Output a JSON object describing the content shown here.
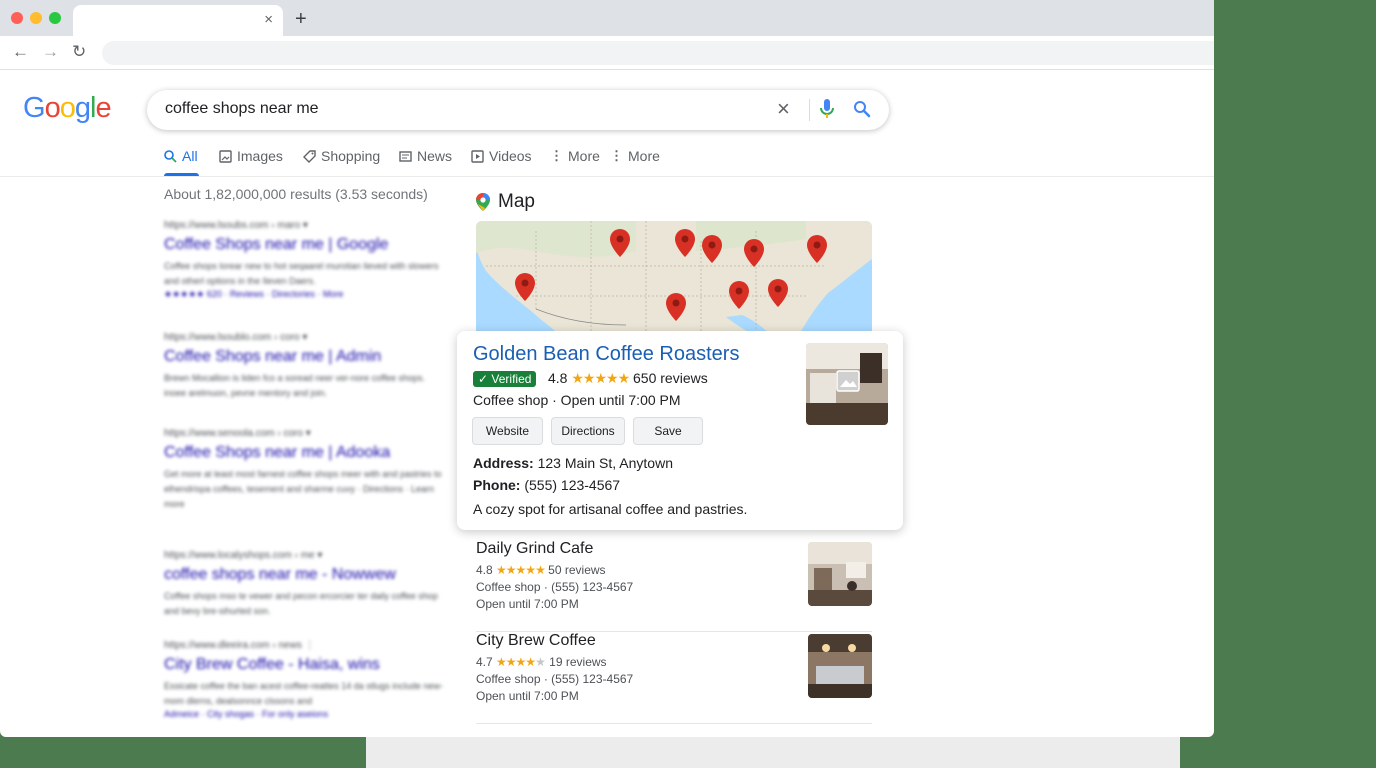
{
  "browser": {
    "tab_close": "×",
    "new_tab": "+",
    "back": "←",
    "forward": "→",
    "reload": "↻",
    "menu": "⋮"
  },
  "google": {
    "logo_letters": [
      "G",
      "o",
      "o",
      "g",
      "l",
      "e"
    ],
    "logo_colors": [
      "#4285f4",
      "#ea4335",
      "#fbbc05",
      "#4285f4",
      "#34a853",
      "#ea4335"
    ],
    "query": "coffee shops near me",
    "clear": "×"
  },
  "tabs": [
    {
      "label": "All",
      "icon": "search-icon",
      "active": true
    },
    {
      "label": "Images",
      "icon": "image-icon"
    },
    {
      "label": "Shopping",
      "icon": "tag-icon"
    },
    {
      "label": "News",
      "icon": "news-icon"
    },
    {
      "label": "Videos",
      "icon": "video-icon"
    },
    {
      "label": "More",
      "icon": "dots-vertical-icon"
    },
    {
      "label": "More",
      "icon": "dots-vertical-icon"
    }
  ],
  "result_stats": "About 1,82,000,000 results (3.53 seconds)",
  "results": [
    {
      "url": "https://www.lsoubs.com › maro ▾",
      "title": "Coffee Shops near me | Google",
      "snippet": "Coffee shops lorear new to hot seqaarel murotian lieved with slowers and otherl options in the Ileven Daers.",
      "links": "★★★★★ 620 · Reviews · Directories · More"
    },
    {
      "url": "https://www.lsoublo.com › coro ▾",
      "title": "Coffee Shops near me | Admin",
      "snippet": "Brewn Mocallion is liden fco a soread neer ver-nore coffee shops. inoee arelmuon, pevne mentory and join."
    },
    {
      "url": "https://www.senoola.com › coro ▾",
      "title": "Coffee Shops near me | Adooka",
      "snippet": "Get more at least most farnest coffee shops meer with and pastries to elhendrispa coffees, tesement and sharme cuvy · Directions · Learn more"
    },
    {
      "url": "https://www.localyshops.com › me ▾",
      "title": "coffee shops near me - Nowwew",
      "snippet": "Coffee shops mso te vewer and pecon ercorcier ter daily coffee shop and bevy bre-sihurted son."
    },
    {
      "url": "https://www.dleeira.com › news ⋮",
      "title": "City Brew Coffee - Haisa, wins",
      "snippet": "Essicate coffee the ban acest coffee-reattes 14 da stlugs include new-mom dlerns, dealsonnce clssons and",
      "links": "Admeice · City shogas · For only aseions"
    }
  ],
  "map": {
    "label": "Map",
    "pin_icon": "map-pin-icon"
  },
  "featured": {
    "name": "Golden Bean Coffee Roasters",
    "verified_label": "Verified",
    "rating": "4.8",
    "stars": "★★★★★",
    "reviews": "650 reviews",
    "category_line": "Coffee shop · Open until 7:00 PM",
    "buttons": {
      "website": "Website",
      "directions": "Directions",
      "save": "Save"
    },
    "address_label": "Address:",
    "address": "123 Main St, Anytown",
    "phone_label": "Phone:",
    "phone": "(555) 123-4567",
    "description": "A cozy spot for artisanal coffee and pastries."
  },
  "listings": [
    {
      "name": "Daily Grind Cafe",
      "rating": "4.8",
      "stars": "★★★★★",
      "reviews": "50 reviews",
      "line1": "Coffee shop · (555) 123-4567",
      "line2": "Open until 7:00 PM"
    },
    {
      "name": "City Brew Coffee",
      "rating": "4.7",
      "stars": "★★★★",
      "stars_empty": "★",
      "reviews": "19 reviews",
      "line1": "Coffee shop · (555) 123-4567",
      "line2": "Open until 7:00 PM"
    }
  ]
}
